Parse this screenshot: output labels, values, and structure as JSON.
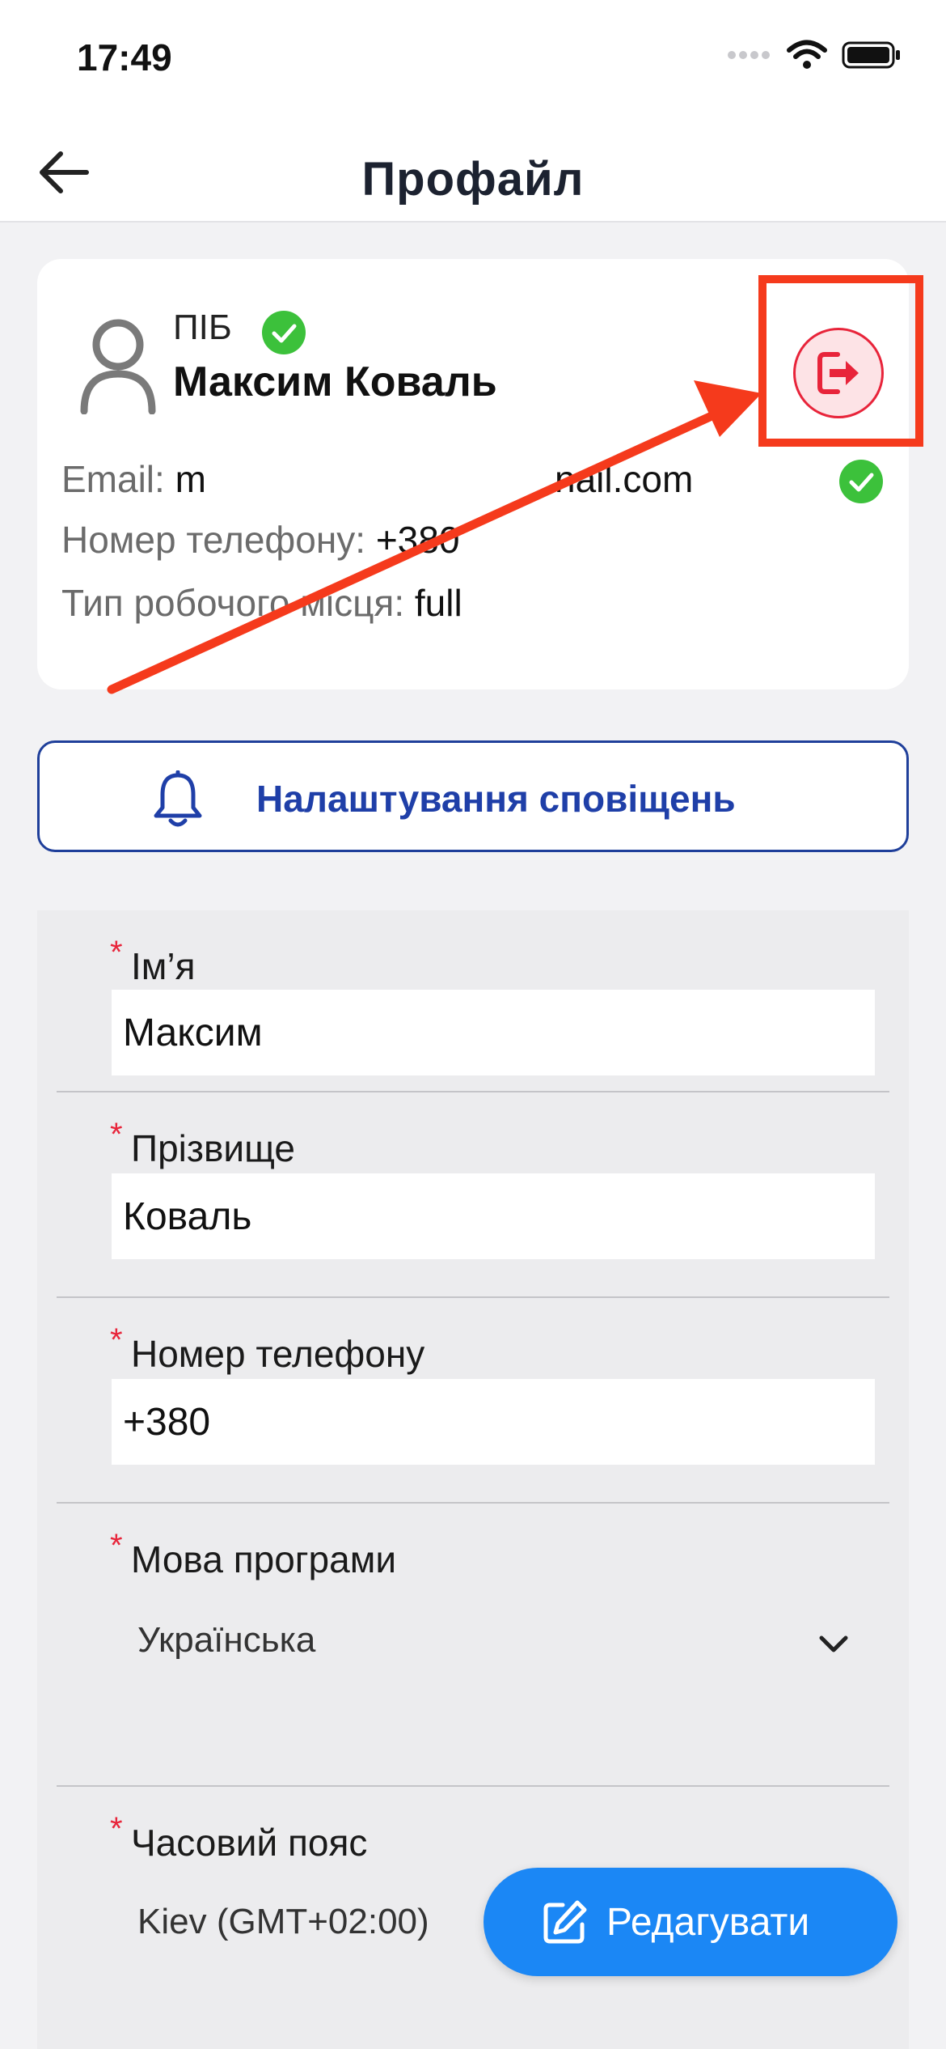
{
  "status_bar": {
    "time": "17:49"
  },
  "header": {
    "title": "Профайл"
  },
  "profile": {
    "pib_label": "ПІБ",
    "full_name": "Максим Коваль",
    "email_label": "Email:",
    "email_value_start": "m",
    "email_value_end": "nail.com",
    "phone_label": "Номер телефону:",
    "phone_value": "+380",
    "workplace_label": "Тип робочого місця:",
    "workplace_value": "full"
  },
  "notifications_button": {
    "label": "Налаштування сповіщень"
  },
  "form": {
    "required_mark": "*",
    "first_name": {
      "label": "Ім’я",
      "value": "Максим"
    },
    "last_name": {
      "label": "Прізвище",
      "value": "Коваль"
    },
    "phone": {
      "label": "Номер телефону",
      "value": "+380"
    },
    "language": {
      "label": "Мова програми",
      "value": "Українська"
    },
    "timezone": {
      "label": "Часовий пояс",
      "value": "Kiev (GMT+02:00)"
    }
  },
  "edit_button": {
    "label": "Редагувати"
  },
  "colors": {
    "accent_blue": "#1b87f5",
    "nav_blue": "#1f3fa8",
    "logout_red": "#e8243a",
    "verified_green": "#3cc13b",
    "annotation_red": "#f53a1c"
  },
  "icons": {
    "back": "arrow-left-icon",
    "logout": "logout-icon",
    "verified": "check-circle-icon",
    "avatar": "user-icon",
    "bell": "bell-icon",
    "chevron": "chevron-down-icon",
    "edit": "edit-icon"
  }
}
